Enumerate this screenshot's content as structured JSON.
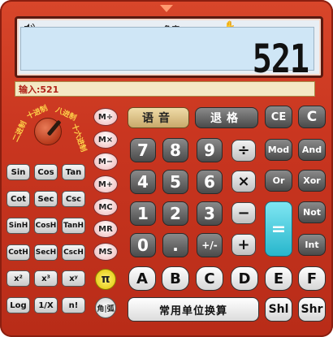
{
  "display": {
    "speaker_icon": "speaker-icon",
    "angle_mode": "角度",
    "hand_icon": "hand-cursor-icon",
    "value": "521"
  },
  "input_bar": {
    "text": "输入:521"
  },
  "dial": {
    "labels": {
      "bin": "二进制",
      "dec": "十进制",
      "oct": "八进制",
      "hex": "十六进制"
    }
  },
  "keys": {
    "voice": "语音",
    "backspace": "退格",
    "ce": "CE",
    "c": "C",
    "mem_div": "M÷",
    "mem_mul": "M×",
    "mem_sub": "M−",
    "mem_add": "M+",
    "mc": "MC",
    "mr": "MR",
    "ms": "MS",
    "d7": "7",
    "d8": "8",
    "d9": "9",
    "d4": "4",
    "d5": "5",
    "d6": "6",
    "d1": "1",
    "d2": "2",
    "d3": "3",
    "d0": "0",
    "dot": ".",
    "sign": "+/-",
    "div": "÷",
    "mul": "×",
    "sub": "−",
    "add": "+",
    "eq": "=",
    "mod": "Mod",
    "and": "And",
    "or": "Or",
    "xor": "Xor",
    "not": "Not",
    "int": "Int",
    "sin": "Sin",
    "cos": "Cos",
    "tan": "Tan",
    "cot": "Cot",
    "sec": "Sec",
    "csc": "Csc",
    "sinh": "SinH",
    "cosh": "CosH",
    "tanh": "TanH",
    "coth": "CotH",
    "sech": "SecH",
    "csch": "CscH",
    "sq": "x²",
    "cube": "x³",
    "pow": "xʸ",
    "log": "Log",
    "recip": "1/X",
    "fact": "n!",
    "pi": "π",
    "angle_unit": "角|弧",
    "A": "A",
    "B": "B",
    "C": "C",
    "D": "D",
    "E": "E",
    "F": "F",
    "units": "常用单位换算",
    "shl": "Shl",
    "shr": "Shr"
  }
}
